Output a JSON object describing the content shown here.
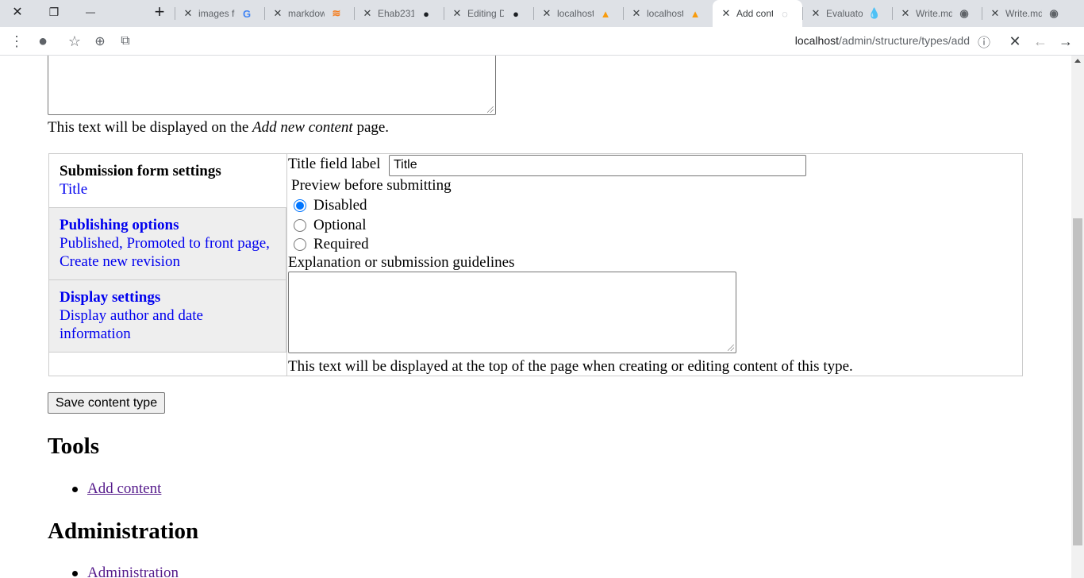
{
  "browser": {
    "window_controls": {
      "close": "✕",
      "restore": "❐",
      "minimize": "—",
      "new_tab": "+"
    },
    "tabs": [
      {
        "title": "images fo",
        "favicon": "G",
        "favicon_color": "#4285f4",
        "active": false
      },
      {
        "title": "markdow",
        "favicon": "≋",
        "favicon_color": "#f48024",
        "active": false
      },
      {
        "title": "Ehab231",
        "favicon": "●",
        "favicon_color": "#1b1f23",
        "active": false
      },
      {
        "title": "Editing D",
        "favicon": "●",
        "favicon_color": "#1b1f23",
        "active": false
      },
      {
        "title": "localhost",
        "favicon": "▲",
        "favicon_color": "#f89c0e",
        "active": false
      },
      {
        "title": "localhost",
        "favicon": "▲",
        "favicon_color": "#f89c0e",
        "active": false
      },
      {
        "title": "Add cont",
        "favicon": "◌",
        "favicon_color": "#9aa0a6",
        "active": true
      },
      {
        "title": "Evaluator",
        "favicon": "💧",
        "favicon_color": "#0678be",
        "active": false
      },
      {
        "title": "Write.md",
        "favicon": "◉",
        "favicon_color": "#5f6368",
        "active": false
      },
      {
        "title": "Write.md",
        "favicon": "◉",
        "favicon_color": "#5f6368",
        "active": false
      }
    ],
    "toolbar": {
      "menu": "⋮",
      "account": "●",
      "star": "☆",
      "zoom": "⊕",
      "extension": "⧉",
      "url_host": "localhost",
      "url_path": "/admin/structure/types/add",
      "info": "ⓘ",
      "stop": "✕",
      "back": "←",
      "forward": "→"
    }
  },
  "page": {
    "description_help_before": "This text will be displayed on the ",
    "description_help_em": "Add new content",
    "description_help_after": " page.",
    "vertical_tabs": [
      {
        "title": "Submission form settings",
        "summary": "Title",
        "selected": true
      },
      {
        "title": "Publishing options",
        "summary": "Published, Promoted to front page, Create new revision",
        "selected": false
      },
      {
        "title": "Display settings",
        "summary": "Display author and date information",
        "selected": false
      }
    ],
    "submission": {
      "title_field_label": "Title field label",
      "title_field_value": "Title",
      "preview_label": "Preview before submitting",
      "preview_options": [
        {
          "label": "Disabled",
          "checked": true
        },
        {
          "label": "Optional",
          "checked": false
        },
        {
          "label": "Required",
          "checked": false
        }
      ],
      "explanation_label": "Explanation or submission guidelines",
      "explanation_help": "This text will be displayed at the top of the page when creating or editing content of this type."
    },
    "save_button": "Save content type",
    "tools": {
      "heading": "Tools",
      "links": [
        "Add content"
      ]
    },
    "administration": {
      "heading": "Administration",
      "links": [
        "Administration"
      ]
    }
  }
}
